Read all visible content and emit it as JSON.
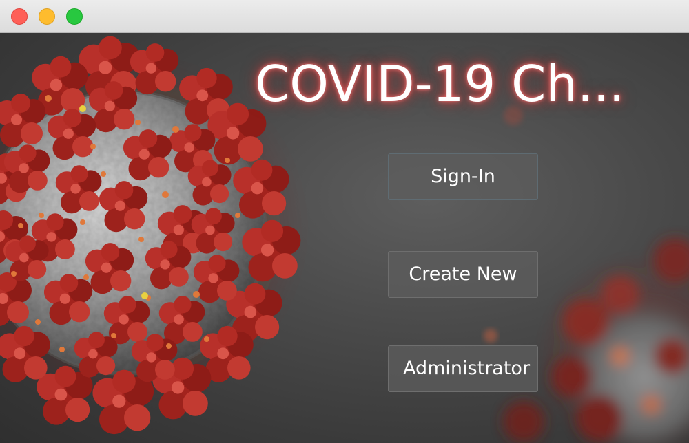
{
  "window": {
    "controls": {
      "close_icon": "close-traffic-light-icon",
      "minimize_icon": "minimize-traffic-light-icon",
      "zoom_icon": "zoom-traffic-light-icon",
      "colors": {
        "close": "#fe5f57",
        "minimize": "#febc2e",
        "zoom": "#28c840"
      }
    }
  },
  "main": {
    "title": "COVID-19 Ch...",
    "title_glow_color": "#e03c3c",
    "background_image": "coronavirus-illustration",
    "buttons": {
      "signin_label": "Sign-In",
      "create_label": "Create New",
      "admin_label": "Administrator"
    }
  }
}
